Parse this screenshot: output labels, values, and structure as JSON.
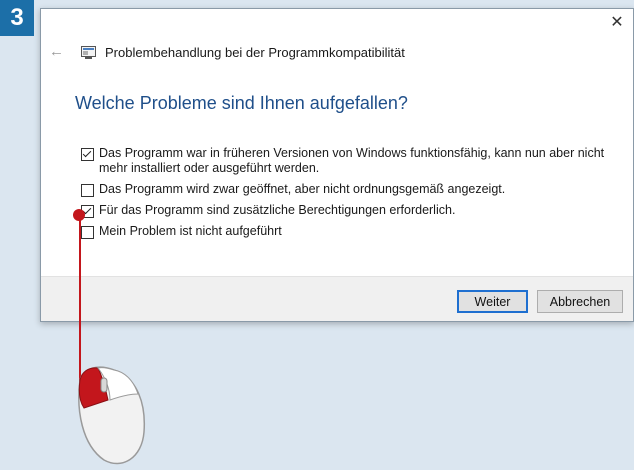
{
  "step": {
    "number": "3"
  },
  "dialog": {
    "title": "Problembehandlung bei der Programmkompatibilität",
    "question": "Welche Probleme sind Ihnen aufgefallen?",
    "options": [
      {
        "label": "Das Programm war in früheren Versionen von Windows funktionsfähig, kann nun aber nicht mehr installiert oder ausgeführt werden.",
        "checked": true
      },
      {
        "label": "Das Programm wird zwar geöffnet, aber nicht ordnungsgemäß angezeigt.",
        "checked": false
      },
      {
        "label": "Für das Programm sind zusätzliche Berechtigungen erforderlich.",
        "checked": true
      },
      {
        "label": "Mein Problem ist nicht aufgeführt",
        "checked": false
      }
    ],
    "buttons": {
      "next": "Weiter",
      "cancel": "Abbrechen"
    }
  },
  "icons": {
    "close": "close-icon",
    "back": "back-arrow-icon",
    "app": "troubleshooter-app-icon",
    "mouse": "mouse-icon"
  },
  "colors": {
    "accent": "#1c6fa8",
    "heading": "#1f4f8a",
    "pointer": "#c3161c",
    "primary_border": "#1e6fd0"
  }
}
